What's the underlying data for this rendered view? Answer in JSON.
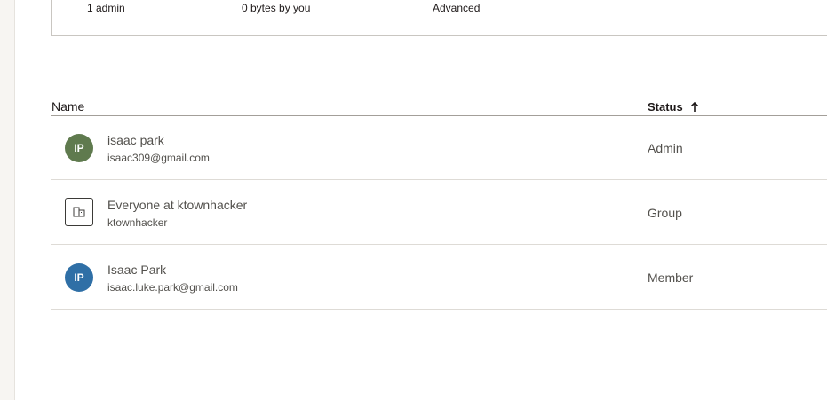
{
  "summary": {
    "admins": "1 admin",
    "storage": "0 bytes by you",
    "plan": "Advanced"
  },
  "table": {
    "columns": {
      "name": "Name",
      "status": "Status"
    },
    "sort": {
      "column": "Status",
      "direction": "ascending",
      "icon": "arrow-up-icon"
    },
    "rows": [
      {
        "initials": "IP",
        "name": "isaac park",
        "sub": "isaac309@gmail.com",
        "status": "Admin",
        "avatar_color": "#5f7a4e",
        "type": "user"
      },
      {
        "initials": "",
        "name": "Everyone at ktownhacker",
        "sub": "ktownhacker",
        "status": "Group",
        "avatar_color": "",
        "type": "group",
        "icon": "building-icon"
      },
      {
        "initials": "IP",
        "name": "Isaac Park",
        "sub": "isaac.luke.park@gmail.com",
        "status": "Member",
        "avatar_color": "#2f6fa6",
        "type": "user"
      }
    ]
  }
}
